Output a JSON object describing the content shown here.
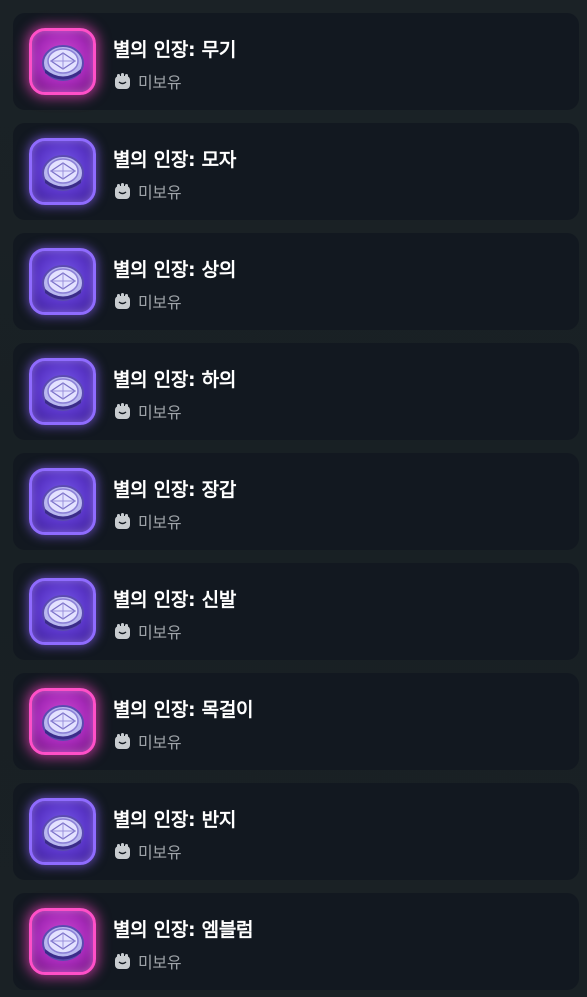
{
  "items": [
    {
      "name": "별의 인장: 무기",
      "status": "미보유",
      "frame": "pink"
    },
    {
      "name": "별의 인장: 모자",
      "status": "미보유",
      "frame": "purple"
    },
    {
      "name": "별의 인장: 상의",
      "status": "미보유",
      "frame": "purple"
    },
    {
      "name": "별의 인장: 하의",
      "status": "미보유",
      "frame": "purple"
    },
    {
      "name": "별의 인장: 장갑",
      "status": "미보유",
      "frame": "purple"
    },
    {
      "name": "별의 인장: 신발",
      "status": "미보유",
      "frame": "purple"
    },
    {
      "name": "별의 인장: 목걸이",
      "status": "미보유",
      "frame": "pink"
    },
    {
      "name": "별의 인장: 반지",
      "status": "미보유",
      "frame": "purple"
    },
    {
      "name": "별의 인장: 엠블럼",
      "status": "미보유",
      "frame": "pink"
    }
  ],
  "icons": {
    "item": "star-seal-gem-icon",
    "status": "fist-lock-icon"
  },
  "colors": {
    "pink_frame": "#ff4fc8",
    "purple_frame": "#8f6bff",
    "card_bg": "#121820"
  }
}
